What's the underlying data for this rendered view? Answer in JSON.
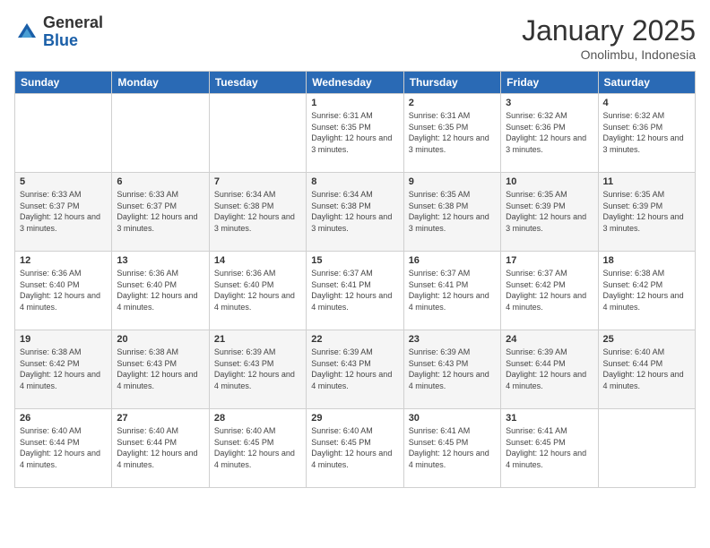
{
  "logo": {
    "general": "General",
    "blue": "Blue"
  },
  "header": {
    "month": "January 2025",
    "location": "Onolimbu, Indonesia"
  },
  "weekdays": [
    "Sunday",
    "Monday",
    "Tuesday",
    "Wednesday",
    "Thursday",
    "Friday",
    "Saturday"
  ],
  "weeks": [
    [
      {
        "day": "",
        "sunrise": "",
        "sunset": "",
        "daylight": ""
      },
      {
        "day": "",
        "sunrise": "",
        "sunset": "",
        "daylight": ""
      },
      {
        "day": "",
        "sunrise": "",
        "sunset": "",
        "daylight": ""
      },
      {
        "day": "1",
        "sunrise": "Sunrise: 6:31 AM",
        "sunset": "Sunset: 6:35 PM",
        "daylight": "Daylight: 12 hours and 3 minutes."
      },
      {
        "day": "2",
        "sunrise": "Sunrise: 6:31 AM",
        "sunset": "Sunset: 6:35 PM",
        "daylight": "Daylight: 12 hours and 3 minutes."
      },
      {
        "day": "3",
        "sunrise": "Sunrise: 6:32 AM",
        "sunset": "Sunset: 6:36 PM",
        "daylight": "Daylight: 12 hours and 3 minutes."
      },
      {
        "day": "4",
        "sunrise": "Sunrise: 6:32 AM",
        "sunset": "Sunset: 6:36 PM",
        "daylight": "Daylight: 12 hours and 3 minutes."
      }
    ],
    [
      {
        "day": "5",
        "sunrise": "Sunrise: 6:33 AM",
        "sunset": "Sunset: 6:37 PM",
        "daylight": "Daylight: 12 hours and 3 minutes."
      },
      {
        "day": "6",
        "sunrise": "Sunrise: 6:33 AM",
        "sunset": "Sunset: 6:37 PM",
        "daylight": "Daylight: 12 hours and 3 minutes."
      },
      {
        "day": "7",
        "sunrise": "Sunrise: 6:34 AM",
        "sunset": "Sunset: 6:38 PM",
        "daylight": "Daylight: 12 hours and 3 minutes."
      },
      {
        "day": "8",
        "sunrise": "Sunrise: 6:34 AM",
        "sunset": "Sunset: 6:38 PM",
        "daylight": "Daylight: 12 hours and 3 minutes."
      },
      {
        "day": "9",
        "sunrise": "Sunrise: 6:35 AM",
        "sunset": "Sunset: 6:38 PM",
        "daylight": "Daylight: 12 hours and 3 minutes."
      },
      {
        "day": "10",
        "sunrise": "Sunrise: 6:35 AM",
        "sunset": "Sunset: 6:39 PM",
        "daylight": "Daylight: 12 hours and 3 minutes."
      },
      {
        "day": "11",
        "sunrise": "Sunrise: 6:35 AM",
        "sunset": "Sunset: 6:39 PM",
        "daylight": "Daylight: 12 hours and 3 minutes."
      }
    ],
    [
      {
        "day": "12",
        "sunrise": "Sunrise: 6:36 AM",
        "sunset": "Sunset: 6:40 PM",
        "daylight": "Daylight: 12 hours and 4 minutes."
      },
      {
        "day": "13",
        "sunrise": "Sunrise: 6:36 AM",
        "sunset": "Sunset: 6:40 PM",
        "daylight": "Daylight: 12 hours and 4 minutes."
      },
      {
        "day": "14",
        "sunrise": "Sunrise: 6:36 AM",
        "sunset": "Sunset: 6:40 PM",
        "daylight": "Daylight: 12 hours and 4 minutes."
      },
      {
        "day": "15",
        "sunrise": "Sunrise: 6:37 AM",
        "sunset": "Sunset: 6:41 PM",
        "daylight": "Daylight: 12 hours and 4 minutes."
      },
      {
        "day": "16",
        "sunrise": "Sunrise: 6:37 AM",
        "sunset": "Sunset: 6:41 PM",
        "daylight": "Daylight: 12 hours and 4 minutes."
      },
      {
        "day": "17",
        "sunrise": "Sunrise: 6:37 AM",
        "sunset": "Sunset: 6:42 PM",
        "daylight": "Daylight: 12 hours and 4 minutes."
      },
      {
        "day": "18",
        "sunrise": "Sunrise: 6:38 AM",
        "sunset": "Sunset: 6:42 PM",
        "daylight": "Daylight: 12 hours and 4 minutes."
      }
    ],
    [
      {
        "day": "19",
        "sunrise": "Sunrise: 6:38 AM",
        "sunset": "Sunset: 6:42 PM",
        "daylight": "Daylight: 12 hours and 4 minutes."
      },
      {
        "day": "20",
        "sunrise": "Sunrise: 6:38 AM",
        "sunset": "Sunset: 6:43 PM",
        "daylight": "Daylight: 12 hours and 4 minutes."
      },
      {
        "day": "21",
        "sunrise": "Sunrise: 6:39 AM",
        "sunset": "Sunset: 6:43 PM",
        "daylight": "Daylight: 12 hours and 4 minutes."
      },
      {
        "day": "22",
        "sunrise": "Sunrise: 6:39 AM",
        "sunset": "Sunset: 6:43 PM",
        "daylight": "Daylight: 12 hours and 4 minutes."
      },
      {
        "day": "23",
        "sunrise": "Sunrise: 6:39 AM",
        "sunset": "Sunset: 6:43 PM",
        "daylight": "Daylight: 12 hours and 4 minutes."
      },
      {
        "day": "24",
        "sunrise": "Sunrise: 6:39 AM",
        "sunset": "Sunset: 6:44 PM",
        "daylight": "Daylight: 12 hours and 4 minutes."
      },
      {
        "day": "25",
        "sunrise": "Sunrise: 6:40 AM",
        "sunset": "Sunset: 6:44 PM",
        "daylight": "Daylight: 12 hours and 4 minutes."
      }
    ],
    [
      {
        "day": "26",
        "sunrise": "Sunrise: 6:40 AM",
        "sunset": "Sunset: 6:44 PM",
        "daylight": "Daylight: 12 hours and 4 minutes."
      },
      {
        "day": "27",
        "sunrise": "Sunrise: 6:40 AM",
        "sunset": "Sunset: 6:44 PM",
        "daylight": "Daylight: 12 hours and 4 minutes."
      },
      {
        "day": "28",
        "sunrise": "Sunrise: 6:40 AM",
        "sunset": "Sunset: 6:45 PM",
        "daylight": "Daylight: 12 hours and 4 minutes."
      },
      {
        "day": "29",
        "sunrise": "Sunrise: 6:40 AM",
        "sunset": "Sunset: 6:45 PM",
        "daylight": "Daylight: 12 hours and 4 minutes."
      },
      {
        "day": "30",
        "sunrise": "Sunrise: 6:41 AM",
        "sunset": "Sunset: 6:45 PM",
        "daylight": "Daylight: 12 hours and 4 minutes."
      },
      {
        "day": "31",
        "sunrise": "Sunrise: 6:41 AM",
        "sunset": "Sunset: 6:45 PM",
        "daylight": "Daylight: 12 hours and 4 minutes."
      },
      {
        "day": "",
        "sunrise": "",
        "sunset": "",
        "daylight": ""
      }
    ]
  ]
}
